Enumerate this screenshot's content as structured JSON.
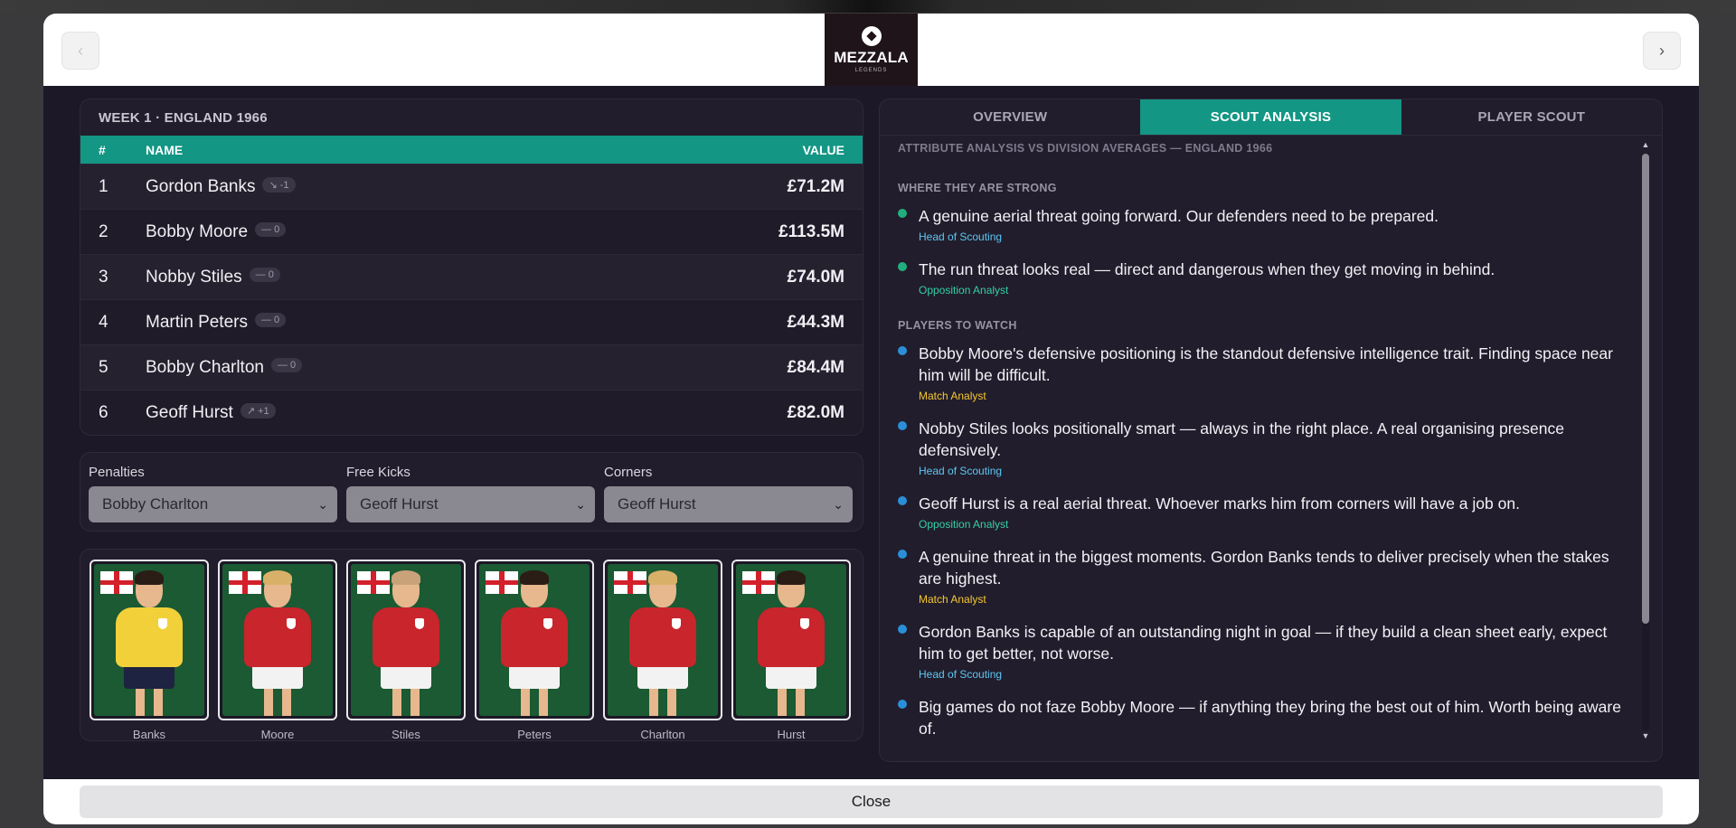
{
  "header": {
    "prev_icon": "chevron-left-icon",
    "next_icon": "chevron-right-icon",
    "logo": {
      "name": "MEZZALA",
      "sub": "LEGENDS"
    }
  },
  "ranking": {
    "title": "WEEK 1 · ENGLAND 1966",
    "columns": {
      "num": "#",
      "name": "NAME",
      "value": "VALUE"
    },
    "rows": [
      {
        "num": "1",
        "name": "Gordon Banks",
        "move": "↘ -1",
        "value": "£71.2M"
      },
      {
        "num": "2",
        "name": "Bobby Moore",
        "move": "— 0",
        "value": "£113.5M"
      },
      {
        "num": "3",
        "name": "Nobby Stiles",
        "move": "— 0",
        "value": "£74.0M"
      },
      {
        "num": "4",
        "name": "Martin Peters",
        "move": "— 0",
        "value": "£44.3M"
      },
      {
        "num": "5",
        "name": "Bobby Charlton",
        "move": "— 0",
        "value": "£84.4M"
      },
      {
        "num": "6",
        "name": "Geoff Hurst",
        "move": "↗ +1",
        "value": "£82.0M"
      }
    ]
  },
  "set_pieces": {
    "penalties": {
      "label": "Penalties",
      "value": "Bobby Charlton"
    },
    "free_kicks": {
      "label": "Free Kicks",
      "value": "Geoff Hurst"
    },
    "corners": {
      "label": "Corners",
      "value": "Geoff Hurst"
    }
  },
  "cards": [
    {
      "name": "Banks",
      "shirt": "#f2d03a",
      "shorts": "#1d2340",
      "hair": "#2a1d15"
    },
    {
      "name": "Moore",
      "shirt": "#c8252c",
      "shorts": "#f2f2f2",
      "hair": "#d9b068"
    },
    {
      "name": "Stiles",
      "shirt": "#c8252c",
      "shorts": "#f2f2f2",
      "hair": "#caa27a"
    },
    {
      "name": "Peters",
      "shirt": "#c8252c",
      "shorts": "#f2f2f2",
      "hair": "#2a1d15"
    },
    {
      "name": "Charlton",
      "shirt": "#c8252c",
      "shorts": "#f2f2f2",
      "hair": "#d9b068"
    },
    {
      "name": "Hurst",
      "shirt": "#c8252c",
      "shorts": "#f2f2f2",
      "hair": "#2a1d15"
    }
  ],
  "tabs": [
    "OVERVIEW",
    "SCOUT ANALYSIS",
    "PLAYER SCOUT"
  ],
  "scout": {
    "heading": "ATTRIBUTE ANALYSIS VS DIVISION AVERAGES — ENGLAND 1966",
    "strong_label": "WHERE THEY ARE STRONG",
    "strong": [
      {
        "text": "A genuine aerial threat going forward. Our defenders need to be prepared.",
        "source": "Head of Scouting",
        "src_class": "src-head"
      },
      {
        "text": "The run threat looks real — direct and dangerous when they get moving in behind.",
        "source": "Opposition Analyst",
        "src_class": "src-opp"
      }
    ],
    "watch_label": "PLAYERS TO WATCH",
    "watch": [
      {
        "text": "Bobby Moore's defensive positioning is the standout defensive intelligence trait. Finding space near him will be difficult.",
        "source": "Match Analyst",
        "src_class": "src-match"
      },
      {
        "text": "Nobby Stiles looks positionally smart — always in the right place. A real organising presence defensively.",
        "source": "Head of Scouting",
        "src_class": "src-head"
      },
      {
        "text": "Geoff Hurst is a real aerial threat. Whoever marks him from corners will have a job on.",
        "source": "Opposition Analyst",
        "src_class": "src-opp"
      },
      {
        "text": "A genuine threat in the biggest moments. Gordon Banks tends to deliver precisely when the stakes are highest.",
        "source": "Match Analyst",
        "src_class": "src-match"
      },
      {
        "text": "Gordon Banks is capable of an outstanding night in goal — if they build a clean sheet early, expect him to get better, not worse.",
        "source": "Head of Scouting",
        "src_class": "src-head"
      },
      {
        "text": "Big games do not faze Bobby Moore — if anything they bring the best out of him. Worth being aware of.",
        "source": "",
        "src_class": "src-opp"
      }
    ]
  },
  "footer": {
    "close_label": "Close"
  },
  "colors": {
    "accent": "#139684",
    "panel": "#211d2c",
    "modal": "#1c1827"
  }
}
